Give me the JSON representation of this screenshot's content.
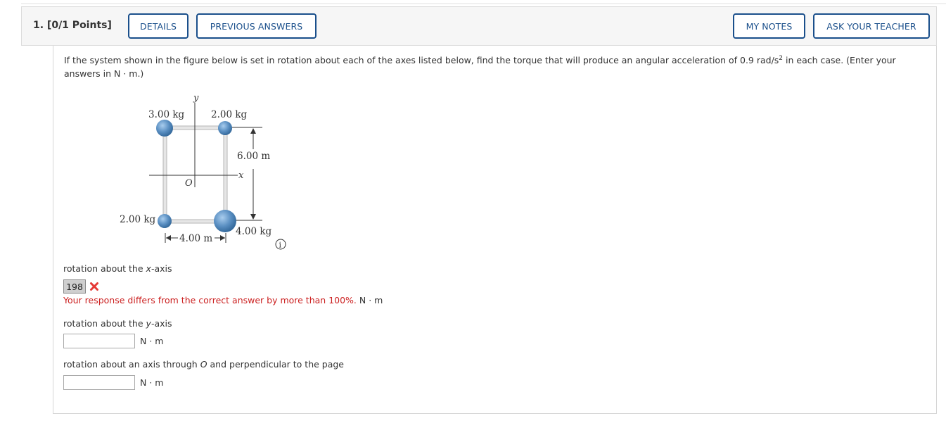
{
  "question": {
    "number_label": "1. [0/1 Points]",
    "buttons": {
      "details": "DETAILS",
      "previous_answers": "PREVIOUS ANSWERS",
      "my_notes": "MY NOTES",
      "ask_teacher": "ASK YOUR TEACHER"
    },
    "prompt_part1": "If the system shown in the figure below is set in rotation about each of the axes listed below, find the torque that will produce an angular acceleration of 0.9 rad/s",
    "prompt_sup": "2",
    "prompt_part2": " in each case. (Enter your answers in N · m.)"
  },
  "figure": {
    "mass_top_left": "3.00 kg",
    "mass_top_right": "2.00 kg",
    "mass_bottom_left": "2.00 kg",
    "mass_bottom_right": "4.00 kg",
    "height_dim": "6.00 m",
    "width_dim": "4.00 m",
    "axis_x": "x",
    "axis_y": "y",
    "origin": "O",
    "info_icon_glyph": "i",
    "mass_color": "#5a8fc2"
  },
  "parts": [
    {
      "label_prefix": "rotation about the ",
      "label_var": "x",
      "label_suffix": "-axis",
      "submitted_value": "198",
      "feedback": "Your response differs from the correct answer by more than 100%.",
      "unit": "N · m"
    },
    {
      "label_prefix": "rotation about the ",
      "label_var": "y",
      "label_suffix": "-axis",
      "value": "",
      "unit": "N · m"
    },
    {
      "label_prefix": "rotation about an axis through ",
      "label_var": "O",
      "label_suffix": " and perpendicular to the page",
      "value": "",
      "unit": "N · m"
    }
  ],
  "colors": {
    "button_border": "#1a4f8b",
    "error_text": "#cc2222",
    "error_icon": "#e53935"
  }
}
